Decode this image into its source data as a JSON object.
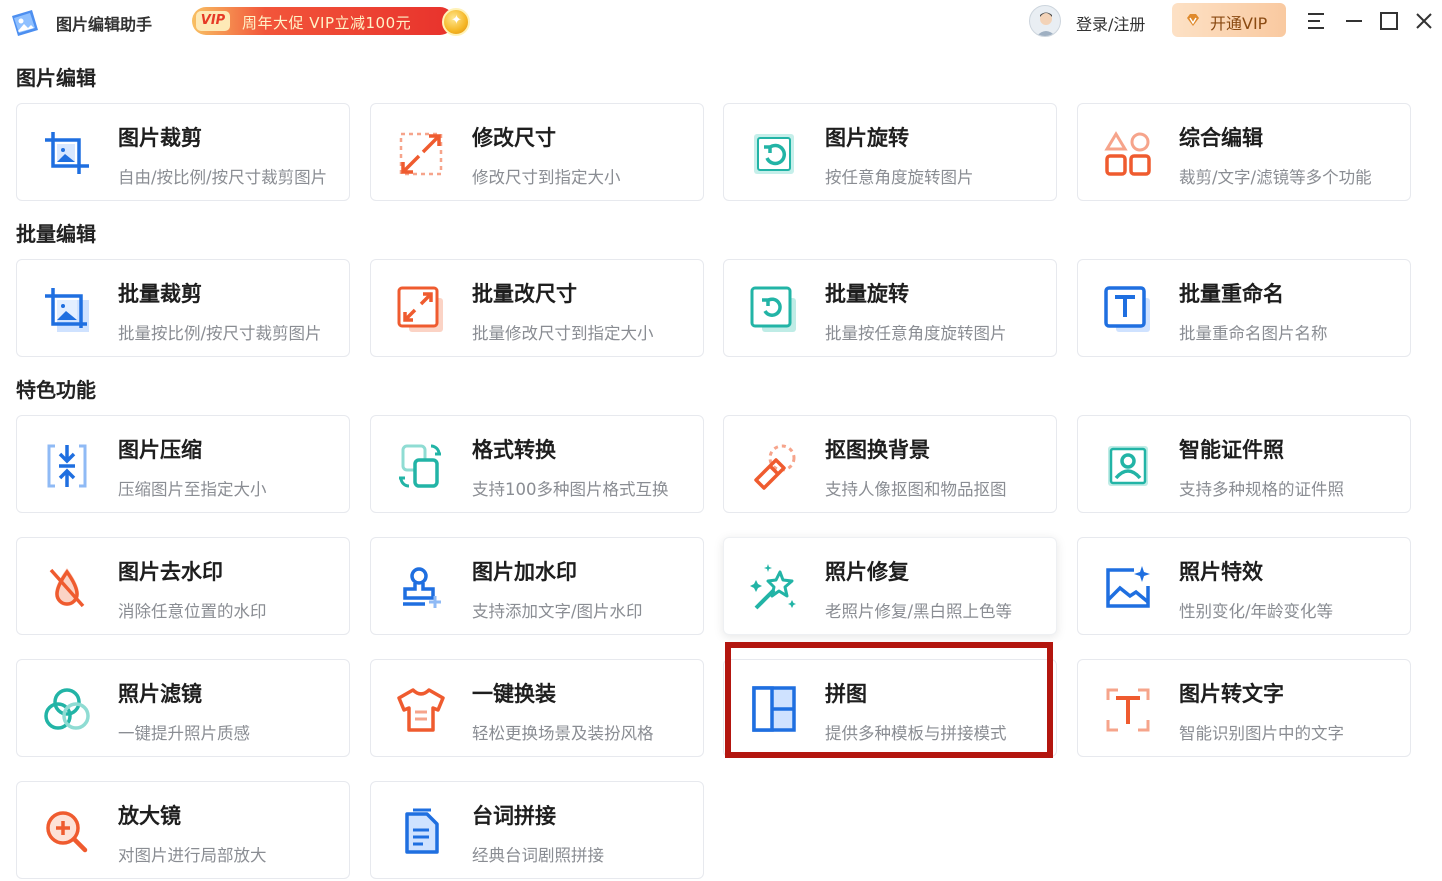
{
  "header": {
    "app_title": "图片编辑助手",
    "promo_badge": "VIP",
    "promo_text": "周年大促 VIP立减100元",
    "login_label": "登录/注册",
    "vip_button_label": "开通VIP"
  },
  "sections": [
    {
      "title": "图片编辑",
      "cards": [
        {
          "title": "图片裁剪",
          "desc": "自由/按比例/按尺寸裁剪图片",
          "icon": "crop-icon"
        },
        {
          "title": "修改尺寸",
          "desc": "修改尺寸到指定大小",
          "icon": "resize-icon"
        },
        {
          "title": "图片旋转",
          "desc": "按任意角度旋转图片",
          "icon": "rotate-icon"
        },
        {
          "title": "综合编辑",
          "desc": "裁剪/文字/滤镜等多个功能",
          "icon": "shapes-icon"
        }
      ]
    },
    {
      "title": "批量编辑",
      "cards": [
        {
          "title": "批量裁剪",
          "desc": "批量按比例/按尺寸裁剪图片",
          "icon": "batch-crop-icon"
        },
        {
          "title": "批量改尺寸",
          "desc": "批量修改尺寸到指定大小",
          "icon": "batch-resize-icon"
        },
        {
          "title": "批量旋转",
          "desc": "批量按任意角度旋转图片",
          "icon": "batch-rotate-icon"
        },
        {
          "title": "批量重命名",
          "desc": "批量重命名图片名称",
          "icon": "batch-rename-icon"
        }
      ]
    },
    {
      "title": "特色功能",
      "cards": [
        {
          "title": "图片压缩",
          "desc": "压缩图片至指定大小",
          "icon": "compress-icon"
        },
        {
          "title": "格式转换",
          "desc": "支持100多种图片格式互换",
          "icon": "format-convert-icon"
        },
        {
          "title": "抠图换背景",
          "desc": "支持人像抠图和物品抠图",
          "icon": "cutout-icon"
        },
        {
          "title": "智能证件照",
          "desc": "支持多种规格的证件照",
          "icon": "id-photo-icon"
        },
        {
          "title": "图片去水印",
          "desc": "消除任意位置的水印",
          "icon": "remove-watermark-icon"
        },
        {
          "title": "图片加水印",
          "desc": "支持添加文字/图片水印",
          "icon": "add-watermark-icon"
        },
        {
          "title": "照片修复",
          "desc": "老照片修复/黑白照上色等",
          "icon": "magic-wand-icon"
        },
        {
          "title": "照片特效",
          "desc": "性别变化/年龄变化等",
          "icon": "photo-effect-icon"
        },
        {
          "title": "照片滤镜",
          "desc": "一键提升照片质感",
          "icon": "filter-icon"
        },
        {
          "title": "一键换装",
          "desc": "轻松更换场景及装扮风格",
          "icon": "outfit-icon"
        },
        {
          "title": "拼图",
          "desc": "提供多种模板与拼接模式",
          "icon": "collage-icon"
        },
        {
          "title": "图片转文字",
          "desc": "智能识别图片中的文字",
          "icon": "ocr-text-icon"
        },
        {
          "title": "放大镜",
          "desc": "对图片进行局部放大",
          "icon": "magnifier-icon"
        },
        {
          "title": "台词拼接",
          "desc": "经典台词剧照拼接",
          "icon": "subtitle-stitch-icon"
        }
      ]
    }
  ],
  "colors": {
    "highlight_border": "#b3160f",
    "blue": "#1f6fe0",
    "orange": "#ef5b2f",
    "teal": "#22b4a6"
  }
}
